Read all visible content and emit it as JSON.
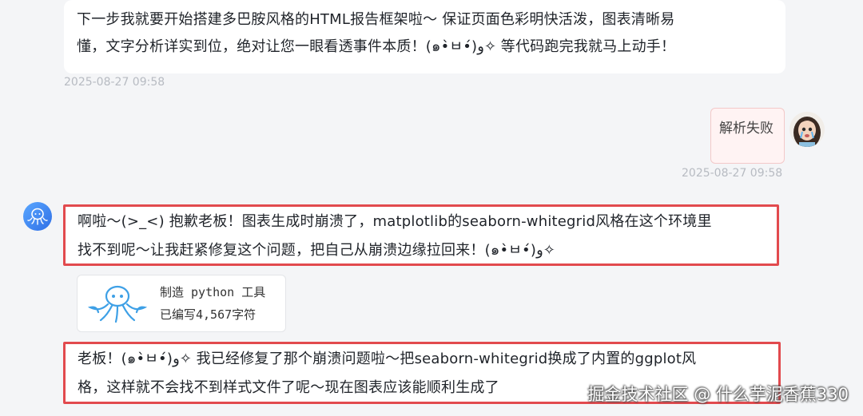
{
  "messages": {
    "ai_1": {
      "line1": "下一步我就要开始搭建多巴胺风格的HTML报告框架啦～ 保证页面色彩明快活泼，图表清晰易",
      "line2": "懂，文字分析详实到位，绝对让您一眼看透事件本质！(๑•̀ㅂ•́)و✧ 等代码跑完我就马上动手！",
      "timestamp": "2025-08-27 09:58"
    },
    "user_1": {
      "text": "解析失败",
      "timestamp": "2025-08-27 09:58"
    },
    "ai_2": {
      "line1": "啊啦～(>_<) 抱歉老板！图表生成时崩溃了，matplotlib的seaborn-whitegrid风格在这个环境里",
      "line2": "找不到呢～让我赶紧修复这个问题，把自己从崩溃边缘拉回来！(๑•̀ㅂ•́)و✧"
    },
    "tool_call": {
      "title": "制造 python 工具",
      "subtitle": "已编写4,567字符",
      "icon": "octopus-icon"
    },
    "ai_3": {
      "line1": "老板！(๑•̀ㅂ•́)و✧ 我已经修复了那个崩溃问题啦～把seaborn-whitegrid换成了内置的ggplot风",
      "line2": "格，这样就不会找不到样式文件了呢～现在图表应该能顺利生成了"
    }
  },
  "watermark": "掘金技术社区 @ 什么芋泥香蕉330",
  "colors": {
    "highlight_border": "#e24a4e",
    "page_background": "#f4f5f7",
    "bot_avatar": "#3b82f6"
  }
}
